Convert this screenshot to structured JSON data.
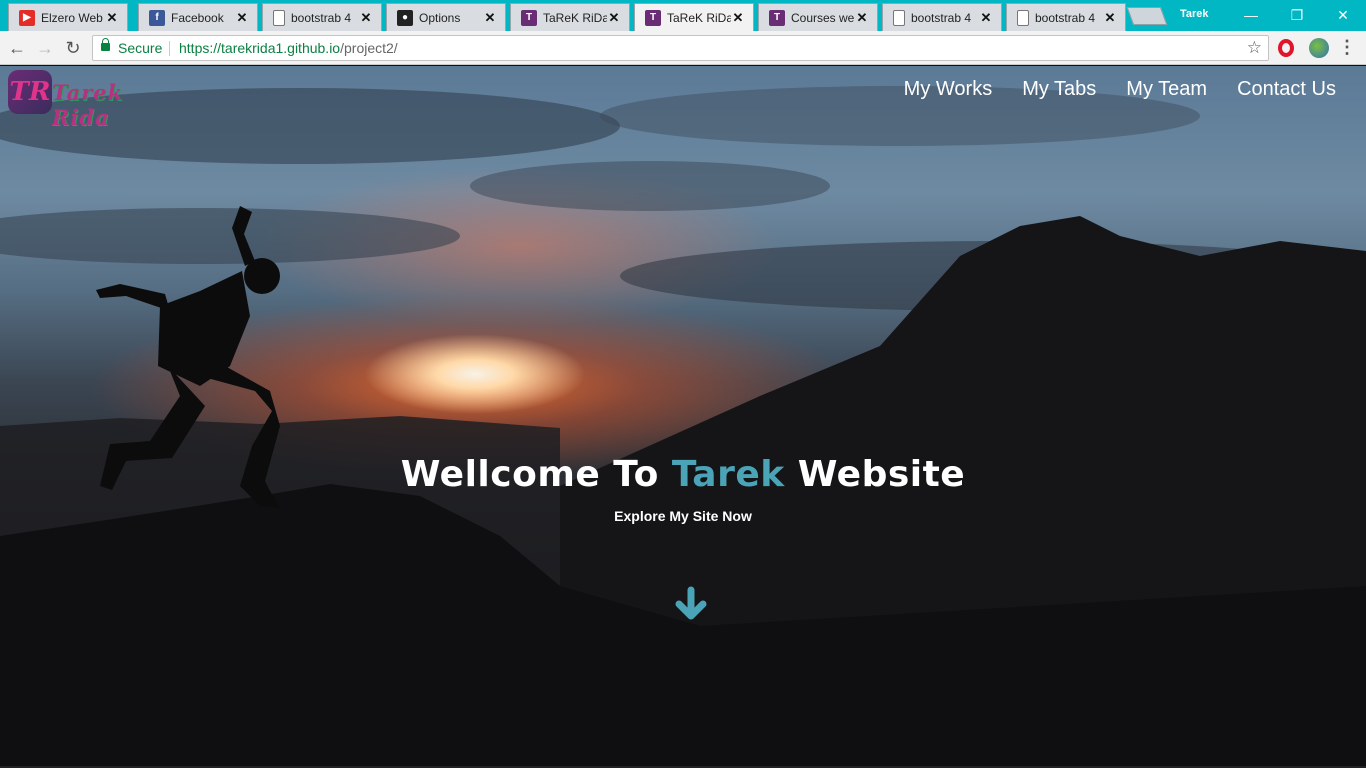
{
  "browser": {
    "tabs": [
      {
        "title": "Elzero Web",
        "icon": "youtube-icon",
        "color": "#e52d27",
        "glyph": "▶"
      },
      {
        "title": "Facebook",
        "icon": "facebook-icon",
        "color": "#3b5998",
        "glyph": "f"
      },
      {
        "title": "bootstrab 4",
        "icon": "page-icon",
        "color": "#ffffff",
        "glyph": ""
      },
      {
        "title": "Options",
        "icon": "github-icon",
        "color": "#222222",
        "glyph": "●"
      },
      {
        "title": "TaReK RiDa",
        "icon": "site-logo-icon",
        "color": "#6b2c76",
        "glyph": "T"
      },
      {
        "title": "TaReK RiDa",
        "icon": "site-logo-icon",
        "color": "#6b2c76",
        "glyph": "T"
      },
      {
        "title": "Courses web",
        "icon": "site-logo-icon",
        "color": "#6b2c76",
        "glyph": "T"
      },
      {
        "title": "bootstrab 4",
        "icon": "page-icon",
        "color": "#ffffff",
        "glyph": ""
      },
      {
        "title": "bootstrab 4",
        "icon": "page-icon",
        "color": "#ffffff",
        "glyph": ""
      }
    ],
    "active_tab": 5,
    "profile_name": "Tarek",
    "security_label": "Secure",
    "url_host": "https://tarekrida1.github.io",
    "url_path": "/project2/"
  },
  "site": {
    "logo_text": "Tarek Rida",
    "logo_letter": "TR",
    "nav": [
      "My Works",
      "My Tabs",
      "My Team",
      "Contact Us"
    ],
    "hero": {
      "title_before": "Wellcome To ",
      "title_accent": "Tarek",
      "title_after": " Website",
      "subtitle": "Explore My Site Now"
    },
    "accent_color": "#4aa3b6"
  }
}
